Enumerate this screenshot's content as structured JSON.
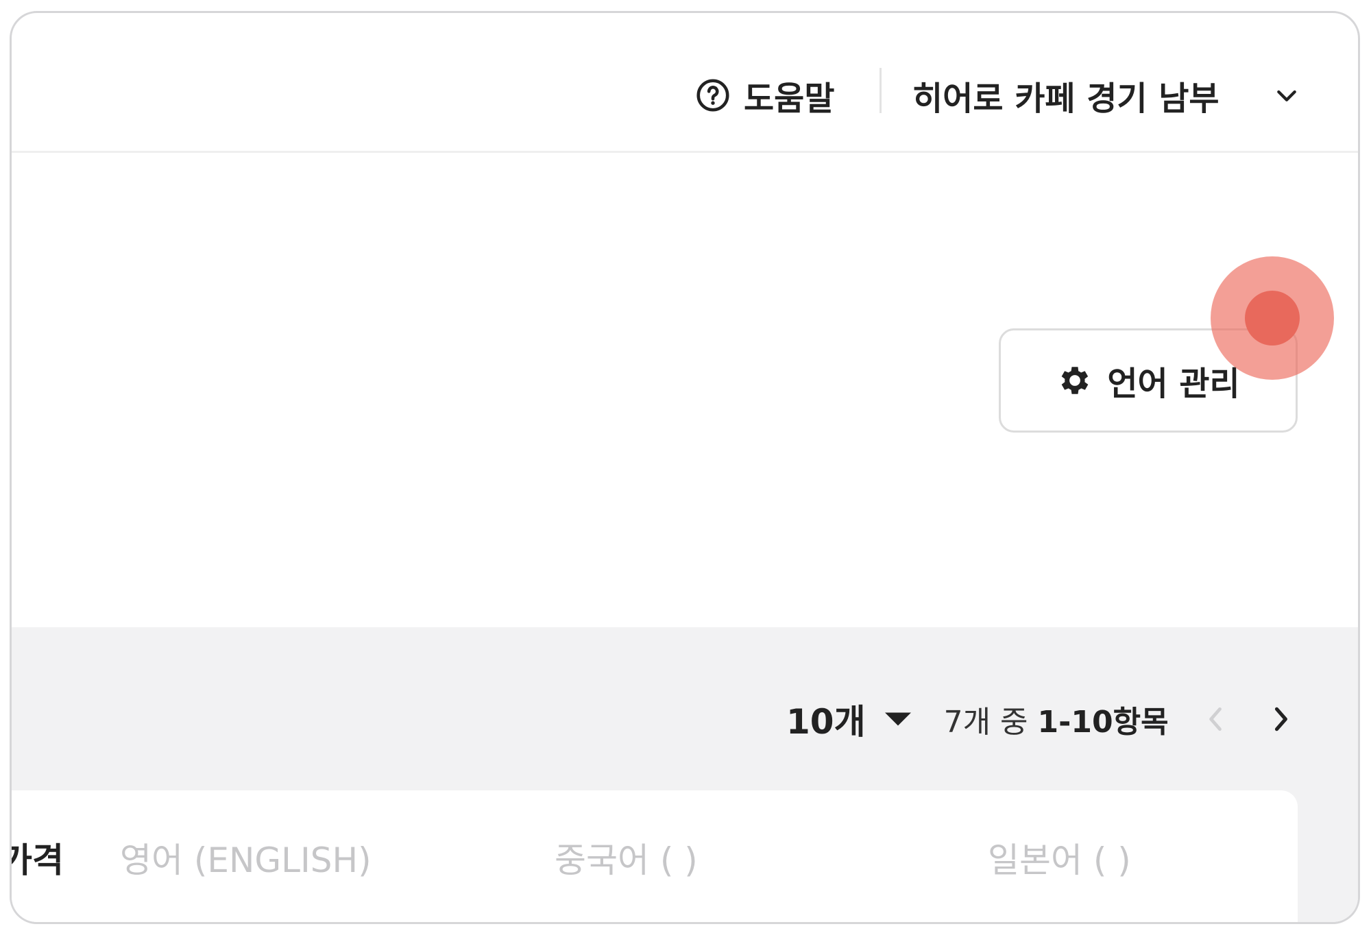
{
  "header": {
    "help_label": "도움말",
    "store_name": "히어로 카페 경기 남부"
  },
  "toolbar": {
    "language_manage_label": "언어 관리"
  },
  "pagination": {
    "page_size": "10개",
    "range_prefix": "7개 중 ",
    "range_bold": "1-10항목"
  },
  "table": {
    "columns": [
      "가격",
      "영어 (ENGLISH)",
      "중국어 (            )",
      "일본어 (            )"
    ]
  },
  "colors": {
    "tap_indicator": "#e8695c",
    "background_gray": "#f2f2f3"
  },
  "icons": [
    "help-circle-icon",
    "chevron-down-icon",
    "gear-icon",
    "caret-down-icon",
    "chevron-left-icon",
    "chevron-right-icon"
  ]
}
